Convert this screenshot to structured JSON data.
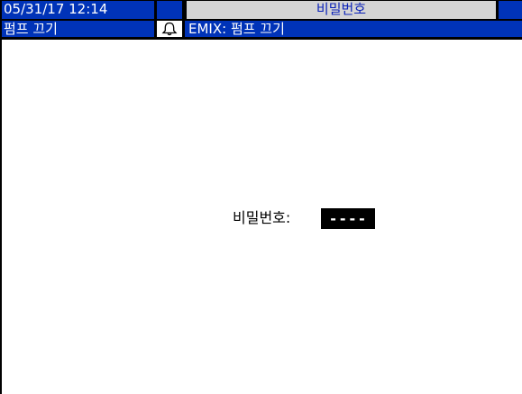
{
  "header": {
    "datetime": "05/31/17 12:14",
    "title": "비밀번호"
  },
  "status_bar": {
    "pump_status": "펌프 끄기",
    "alarm_icon": "bell-icon",
    "message": "EMIX: 펌프 끄기"
  },
  "password_screen": {
    "label": "비밀번호:",
    "value": "----"
  },
  "colors": {
    "header_blue": "#0033b8",
    "title_gray": "#d4d4d4",
    "title_text": "#0b22b8"
  }
}
